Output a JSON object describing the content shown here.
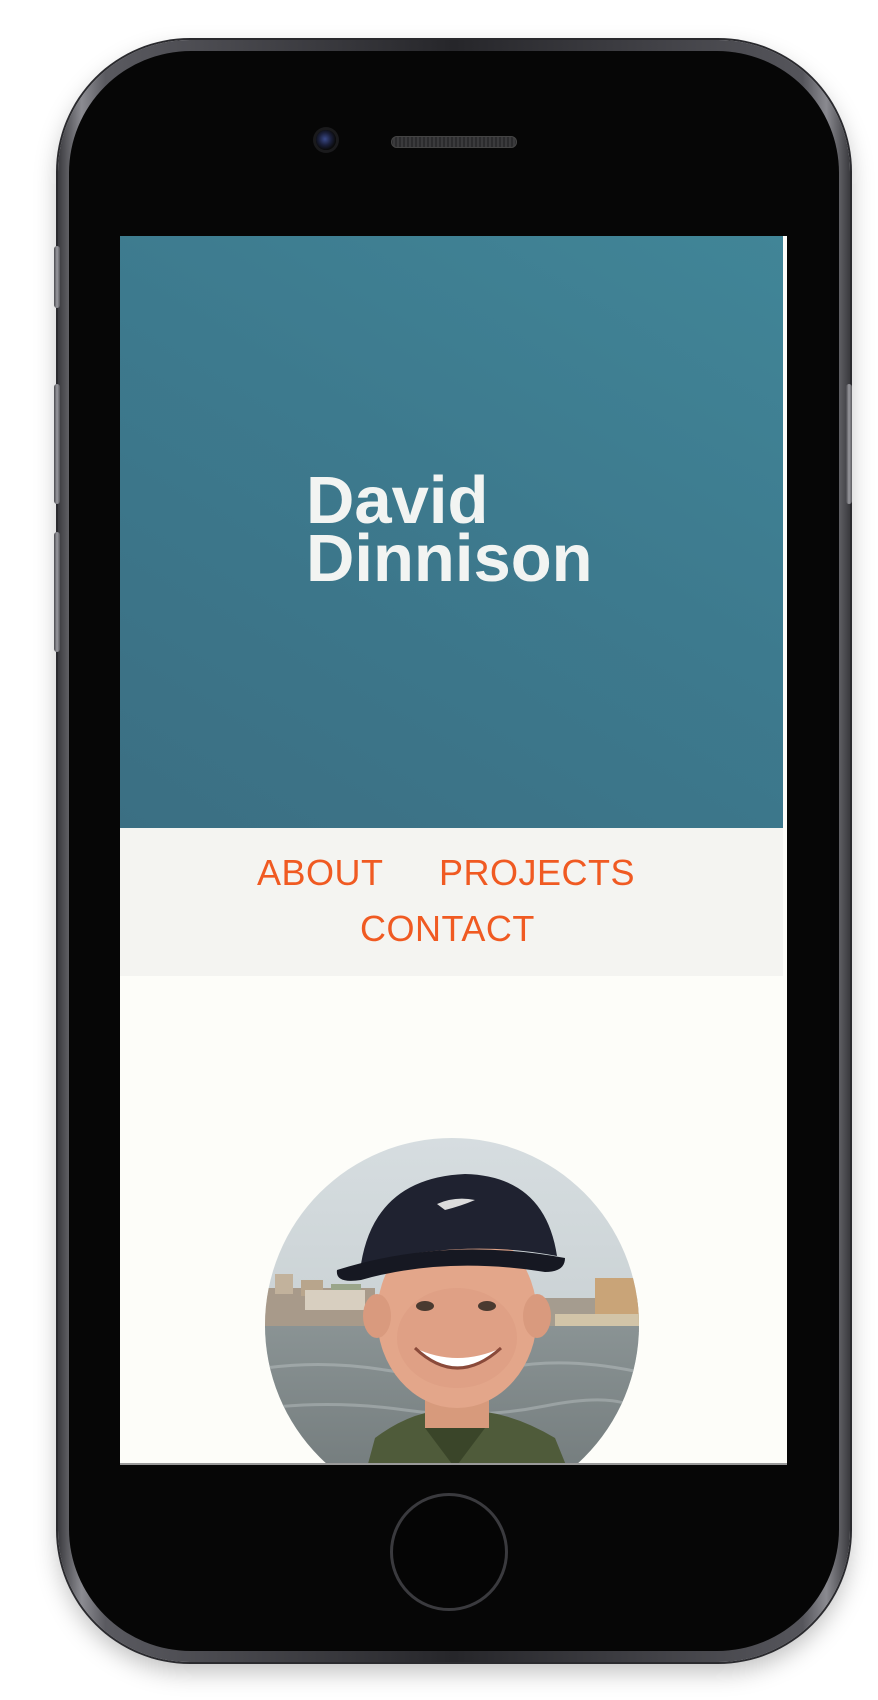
{
  "hero": {
    "name_first": "David",
    "name_last": "Dinnison"
  },
  "nav": {
    "items": [
      {
        "label": "ABOUT"
      },
      {
        "label": "PROJECTS"
      },
      {
        "label": "CONTACT"
      }
    ]
  },
  "colors": {
    "hero_background": "#3d7a8e",
    "nav_link": "#f05a22",
    "nav_background": "#f4f4f1",
    "page_background": "#fdfdf9"
  },
  "profile": {
    "avatar_icon": "profile-photo"
  }
}
